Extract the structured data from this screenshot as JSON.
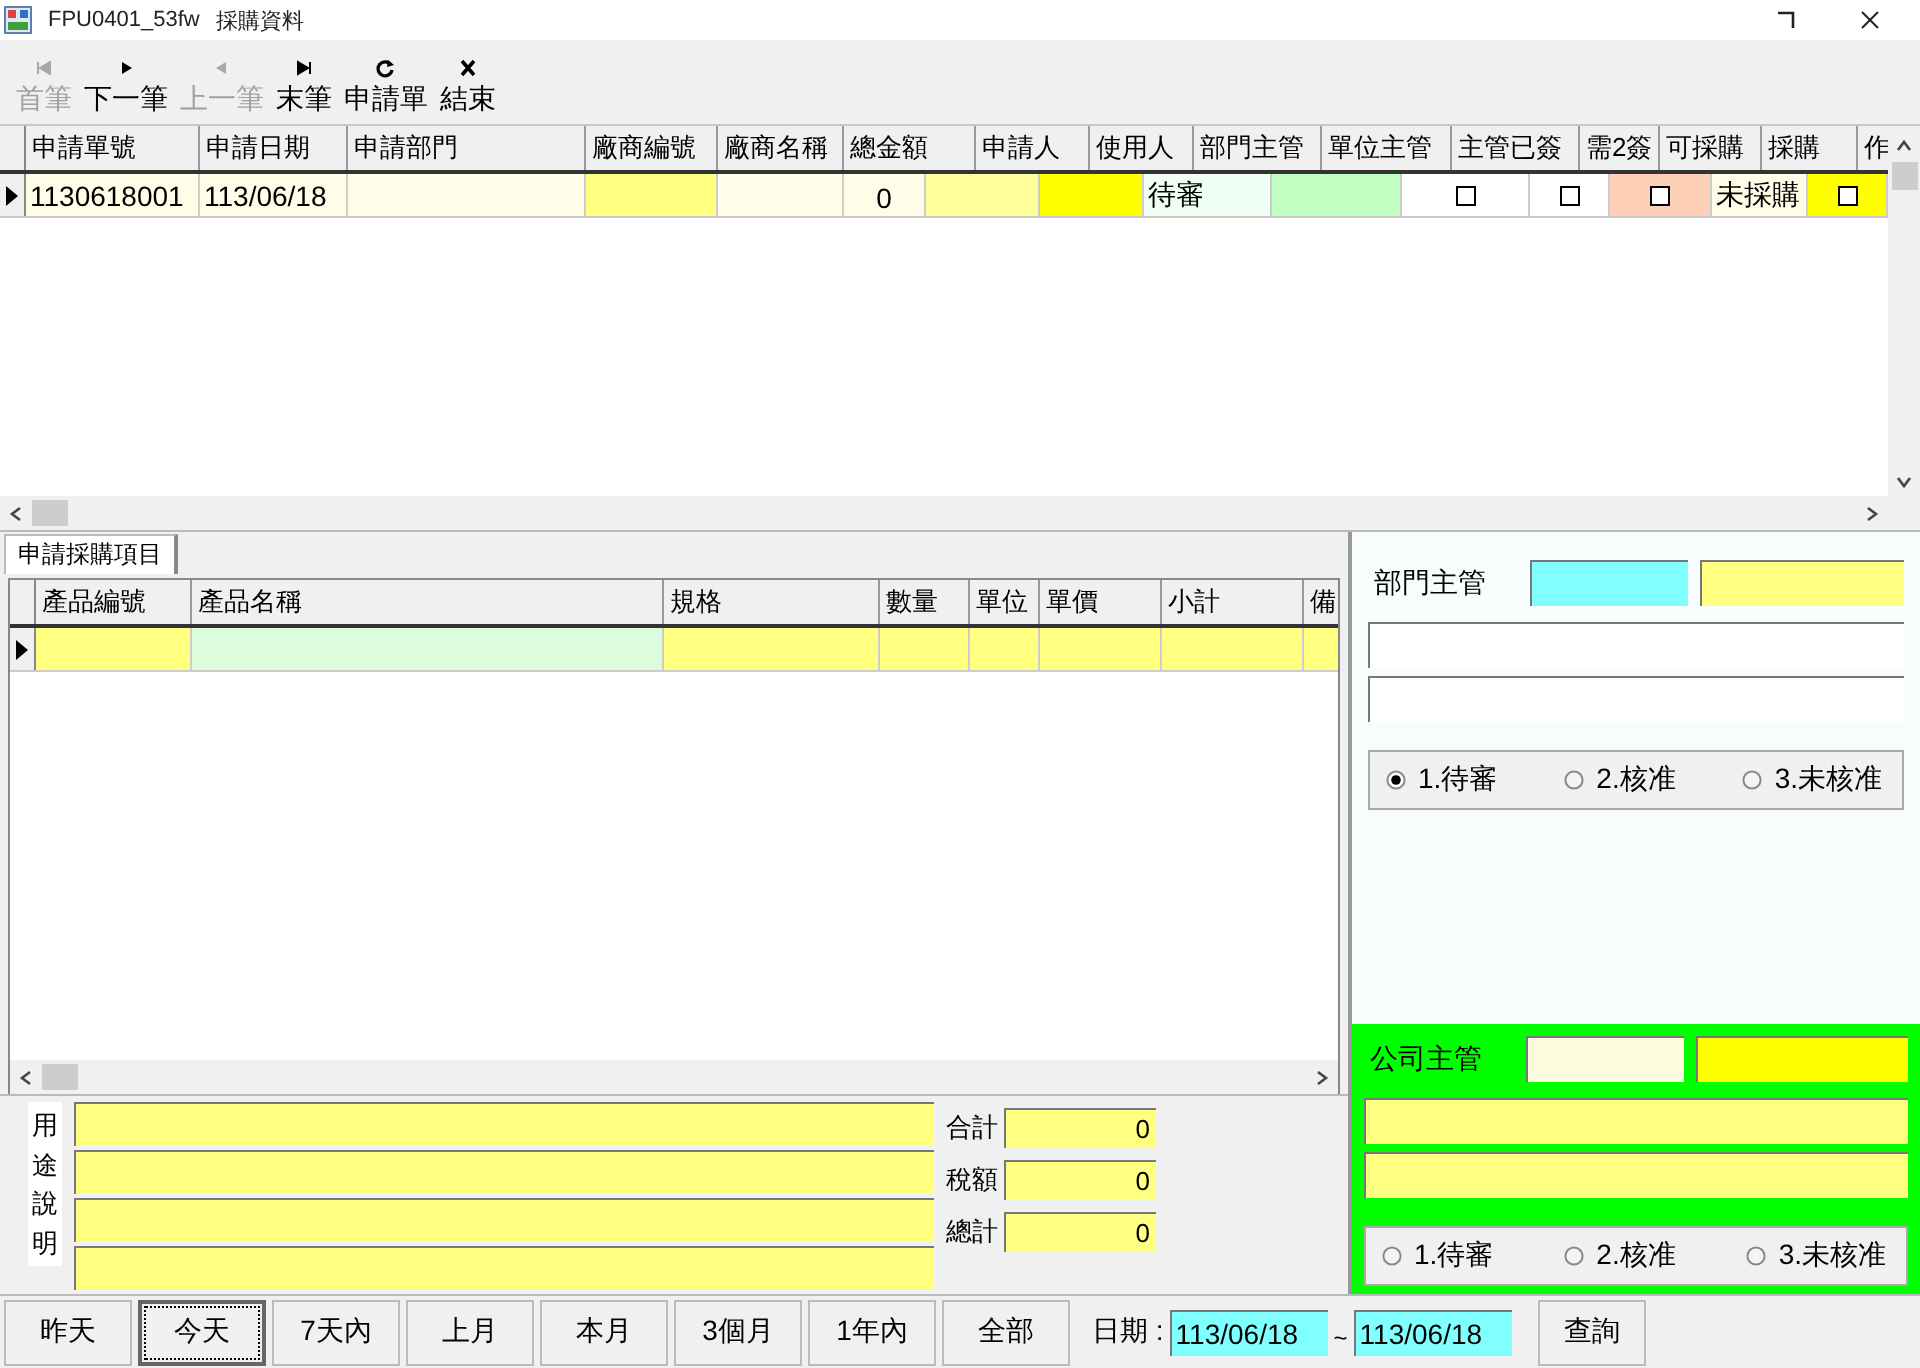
{
  "window": {
    "app_id": "FPU0401_53fw",
    "title": "採購資料"
  },
  "toolbar": [
    {
      "kind": "first",
      "label": "首筆",
      "disabled": true
    },
    {
      "kind": "next",
      "label": "下一筆",
      "disabled": false
    },
    {
      "kind": "prev",
      "label": "上一筆",
      "disabled": true
    },
    {
      "kind": "last",
      "label": "末筆",
      "disabled": false
    },
    {
      "kind": "refresh",
      "label": "申請單",
      "disabled": false
    },
    {
      "kind": "close",
      "label": "結束",
      "disabled": false
    }
  ],
  "requests": {
    "columns": [
      {
        "label": "申請單號",
        "kind": "text",
        "color": "#fffde8"
      },
      {
        "label": "申請日期",
        "kind": "text",
        "color": "#fffde8"
      },
      {
        "label": "申請部門",
        "kind": "text",
        "color": "#fffde8"
      },
      {
        "label": "廠商編號",
        "kind": "text",
        "color": "#ffff80"
      },
      {
        "label": "廠商名稱",
        "kind": "text",
        "color": "#fffde8"
      },
      {
        "label": "總金額",
        "kind": "number",
        "color": "#fffde8"
      },
      {
        "label": "申請人",
        "kind": "text",
        "color": "#ffff99"
      },
      {
        "label": "使用人",
        "kind": "text",
        "color": "#ffff00"
      },
      {
        "label": "部門主管",
        "kind": "text",
        "color": "#f0fff4"
      },
      {
        "label": "單位主管",
        "kind": "text",
        "color": "#c0ffc0"
      },
      {
        "label": "主管已簽",
        "kind": "check",
        "color": "#ffffff"
      },
      {
        "label": "需2簽",
        "kind": "check",
        "color": "#ffffff"
      },
      {
        "label": "可採購",
        "kind": "check",
        "color": "#ffd0b8"
      },
      {
        "label": "採購",
        "kind": "text",
        "color": "#fffde8"
      },
      {
        "label": "作",
        "kind": "check",
        "color": "#ffff00"
      }
    ],
    "rows": [
      {
        "selected": true,
        "cells": [
          {
            "text": "1130618001"
          },
          {
            "text": "113/06/18"
          },
          {},
          {},
          {},
          {
            "text": "0"
          },
          {},
          {},
          {
            "text": "待審"
          },
          {},
          {
            "checked": false
          },
          {
            "checked": false
          },
          {
            "checked": false
          },
          {
            "text": "未採購"
          },
          {
            "checked": false
          }
        ]
      }
    ]
  },
  "tabs": [
    {
      "label": "申請採購項目",
      "selected": true
    }
  ],
  "items": {
    "columns": [
      {
        "label": "產品編號",
        "color": "#ffff80"
      },
      {
        "label": "產品名稱",
        "color": "#dcfcdc"
      },
      {
        "label": "規格",
        "color": "#ffff80"
      },
      {
        "label": "數量",
        "color": "#ffff80"
      },
      {
        "label": "單位",
        "color": "#ffff80"
      },
      {
        "label": "單價",
        "color": "#ffff80"
      },
      {
        "label": "小計",
        "color": "#ffff80"
      },
      {
        "label": "備",
        "color": "#ffff80"
      }
    ],
    "rows": [
      {
        "selected": true
      }
    ]
  },
  "purpose": {
    "label": "用途說明"
  },
  "totals": [
    {
      "label": "合計",
      "value": "0"
    },
    {
      "label": "稅額",
      "value": "0"
    },
    {
      "label": "總計",
      "value": "0"
    }
  ],
  "approvals": [
    {
      "title": "部門主管",
      "highlight": false,
      "options": [
        {
          "label": "1.待審",
          "selected": true
        },
        {
          "label": "2.核准",
          "selected": false
        },
        {
          "label": "3.未核准",
          "selected": false
        }
      ]
    },
    {
      "title": "公司主管",
      "highlight": true,
      "options": [
        {
          "label": "1.待審",
          "selected": false
        },
        {
          "label": "2.核准",
          "selected": false
        },
        {
          "label": "3.未核准",
          "selected": false
        }
      ]
    }
  ],
  "ranges": [
    {
      "label": "昨天",
      "selected": false
    },
    {
      "label": "今天",
      "selected": true
    },
    {
      "label": "7天內",
      "selected": false
    },
    {
      "label": "上月",
      "selected": false
    },
    {
      "label": "本月",
      "selected": false
    },
    {
      "label": "3個月",
      "selected": false
    },
    {
      "label": "1年內",
      "selected": false
    },
    {
      "label": "全部",
      "selected": false
    }
  ],
  "date_filter": {
    "label": "日期 :",
    "from": "113/06/18",
    "separator": "~",
    "to": "113/06/18"
  },
  "query_button": "查詢"
}
